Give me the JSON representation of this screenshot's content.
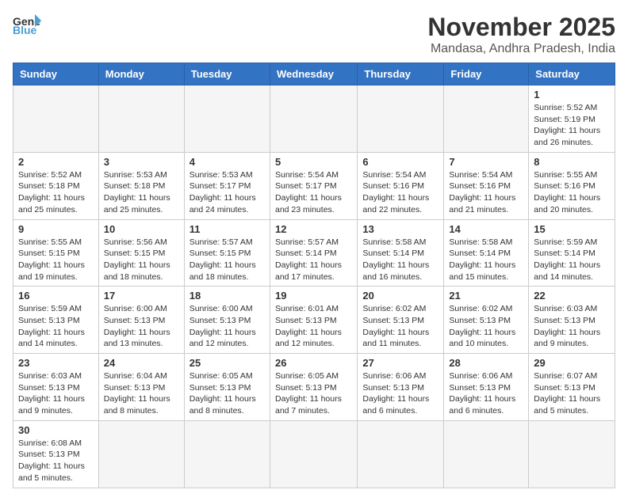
{
  "header": {
    "logo_general": "General",
    "logo_blue": "Blue",
    "month_title": "November 2025",
    "location": "Mandasa, Andhra Pradesh, India"
  },
  "days_of_week": [
    "Sunday",
    "Monday",
    "Tuesday",
    "Wednesday",
    "Thursday",
    "Friday",
    "Saturday"
  ],
  "weeks": [
    [
      {
        "day": "",
        "info": ""
      },
      {
        "day": "",
        "info": ""
      },
      {
        "day": "",
        "info": ""
      },
      {
        "day": "",
        "info": ""
      },
      {
        "day": "",
        "info": ""
      },
      {
        "day": "",
        "info": ""
      },
      {
        "day": "1",
        "info": "Sunrise: 5:52 AM\nSunset: 5:19 PM\nDaylight: 11 hours\nand 26 minutes."
      }
    ],
    [
      {
        "day": "2",
        "info": "Sunrise: 5:52 AM\nSunset: 5:18 PM\nDaylight: 11 hours\nand 25 minutes."
      },
      {
        "day": "3",
        "info": "Sunrise: 5:53 AM\nSunset: 5:18 PM\nDaylight: 11 hours\nand 25 minutes."
      },
      {
        "day": "4",
        "info": "Sunrise: 5:53 AM\nSunset: 5:17 PM\nDaylight: 11 hours\nand 24 minutes."
      },
      {
        "day": "5",
        "info": "Sunrise: 5:54 AM\nSunset: 5:17 PM\nDaylight: 11 hours\nand 23 minutes."
      },
      {
        "day": "6",
        "info": "Sunrise: 5:54 AM\nSunset: 5:16 PM\nDaylight: 11 hours\nand 22 minutes."
      },
      {
        "day": "7",
        "info": "Sunrise: 5:54 AM\nSunset: 5:16 PM\nDaylight: 11 hours\nand 21 minutes."
      },
      {
        "day": "8",
        "info": "Sunrise: 5:55 AM\nSunset: 5:16 PM\nDaylight: 11 hours\nand 20 minutes."
      }
    ],
    [
      {
        "day": "9",
        "info": "Sunrise: 5:55 AM\nSunset: 5:15 PM\nDaylight: 11 hours\nand 19 minutes."
      },
      {
        "day": "10",
        "info": "Sunrise: 5:56 AM\nSunset: 5:15 PM\nDaylight: 11 hours\nand 18 minutes."
      },
      {
        "day": "11",
        "info": "Sunrise: 5:57 AM\nSunset: 5:15 PM\nDaylight: 11 hours\nand 18 minutes."
      },
      {
        "day": "12",
        "info": "Sunrise: 5:57 AM\nSunset: 5:14 PM\nDaylight: 11 hours\nand 17 minutes."
      },
      {
        "day": "13",
        "info": "Sunrise: 5:58 AM\nSunset: 5:14 PM\nDaylight: 11 hours\nand 16 minutes."
      },
      {
        "day": "14",
        "info": "Sunrise: 5:58 AM\nSunset: 5:14 PM\nDaylight: 11 hours\nand 15 minutes."
      },
      {
        "day": "15",
        "info": "Sunrise: 5:59 AM\nSunset: 5:14 PM\nDaylight: 11 hours\nand 14 minutes."
      }
    ],
    [
      {
        "day": "16",
        "info": "Sunrise: 5:59 AM\nSunset: 5:13 PM\nDaylight: 11 hours\nand 14 minutes."
      },
      {
        "day": "17",
        "info": "Sunrise: 6:00 AM\nSunset: 5:13 PM\nDaylight: 11 hours\nand 13 minutes."
      },
      {
        "day": "18",
        "info": "Sunrise: 6:00 AM\nSunset: 5:13 PM\nDaylight: 11 hours\nand 12 minutes."
      },
      {
        "day": "19",
        "info": "Sunrise: 6:01 AM\nSunset: 5:13 PM\nDaylight: 11 hours\nand 12 minutes."
      },
      {
        "day": "20",
        "info": "Sunrise: 6:02 AM\nSunset: 5:13 PM\nDaylight: 11 hours\nand 11 minutes."
      },
      {
        "day": "21",
        "info": "Sunrise: 6:02 AM\nSunset: 5:13 PM\nDaylight: 11 hours\nand 10 minutes."
      },
      {
        "day": "22",
        "info": "Sunrise: 6:03 AM\nSunset: 5:13 PM\nDaylight: 11 hours\nand 9 minutes."
      }
    ],
    [
      {
        "day": "23",
        "info": "Sunrise: 6:03 AM\nSunset: 5:13 PM\nDaylight: 11 hours\nand 9 minutes."
      },
      {
        "day": "24",
        "info": "Sunrise: 6:04 AM\nSunset: 5:13 PM\nDaylight: 11 hours\nand 8 minutes."
      },
      {
        "day": "25",
        "info": "Sunrise: 6:05 AM\nSunset: 5:13 PM\nDaylight: 11 hours\nand 8 minutes."
      },
      {
        "day": "26",
        "info": "Sunrise: 6:05 AM\nSunset: 5:13 PM\nDaylight: 11 hours\nand 7 minutes."
      },
      {
        "day": "27",
        "info": "Sunrise: 6:06 AM\nSunset: 5:13 PM\nDaylight: 11 hours\nand 6 minutes."
      },
      {
        "day": "28",
        "info": "Sunrise: 6:06 AM\nSunset: 5:13 PM\nDaylight: 11 hours\nand 6 minutes."
      },
      {
        "day": "29",
        "info": "Sunrise: 6:07 AM\nSunset: 5:13 PM\nDaylight: 11 hours\nand 5 minutes."
      }
    ],
    [
      {
        "day": "30",
        "info": "Sunrise: 6:08 AM\nSunset: 5:13 PM\nDaylight: 11 hours\nand 5 minutes."
      },
      {
        "day": "",
        "info": ""
      },
      {
        "day": "",
        "info": ""
      },
      {
        "day": "",
        "info": ""
      },
      {
        "day": "",
        "info": ""
      },
      {
        "day": "",
        "info": ""
      },
      {
        "day": "",
        "info": ""
      }
    ]
  ]
}
